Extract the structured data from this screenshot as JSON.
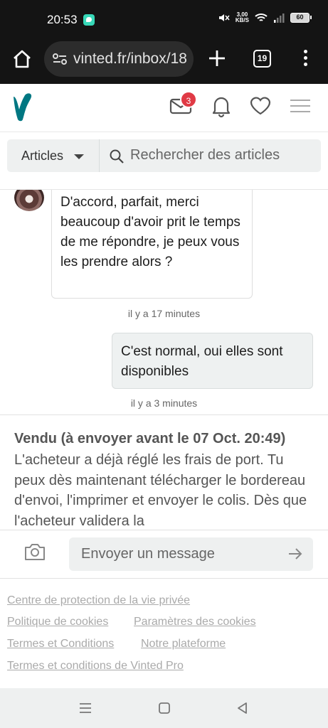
{
  "status_bar": {
    "time": "20:53",
    "app_icon": "chat-bubble-icon",
    "network_speed_value": "3,00",
    "network_speed_unit": "KB/S",
    "battery": "60"
  },
  "browser": {
    "url": "vinted.fr/inbox/18",
    "tab_count": "19",
    "icons": [
      "home-icon",
      "site-settings-icon",
      "plus-icon",
      "tabs-icon",
      "menu-icon"
    ]
  },
  "header": {
    "logo": "V",
    "inbox_badge": "3",
    "brand_color": "#007782",
    "icons": [
      "mail-icon",
      "bell-icon",
      "heart-icon",
      "hamburger-icon"
    ]
  },
  "search": {
    "category_label": "Articles",
    "placeholder": "Rechercher des articles"
  },
  "conversation": {
    "incoming_message": "D'accord, parfait, merci beaucoup d'avoir prit le temps de me répondre, je peux vous les prendre alors ?",
    "incoming_time": "il y a 17 minutes",
    "outgoing_message": "C'est normal, oui elles sont disponibles",
    "outgoing_time": "il y a 3 minutes"
  },
  "order_status": {
    "title": "Vendu (à envoyer avant le 07 Oct. 20:49)",
    "body": "L'acheteur a déjà réglé les frais de port. Tu peux dès maintenant télécharger le bordereau d'envoi, l'imprimer et envoyer le colis. Dès que l'acheteur validera la"
  },
  "composer": {
    "placeholder": "Envoyer un message"
  },
  "footer": {
    "links": [
      "Centre de protection de la vie privée",
      "Politique de cookies",
      "Paramètres des cookies",
      "Termes et Conditions",
      "Notre plateforme",
      "Termes et conditions de Vinted Pro"
    ]
  },
  "system_nav": {
    "icons": [
      "recents-icon",
      "home-square-icon",
      "back-triangle-icon"
    ]
  }
}
